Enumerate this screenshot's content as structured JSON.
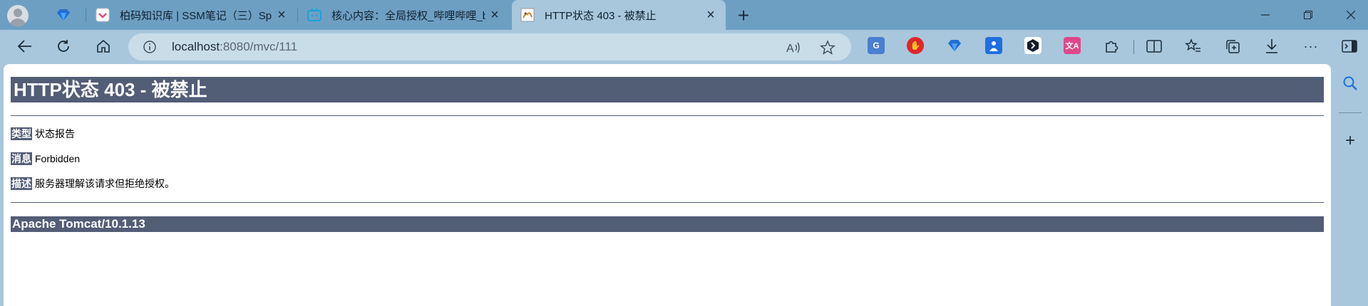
{
  "tabs": [
    {
      "title": "柏码知识库 | SSM笔记（三）Spring",
      "active": false
    },
    {
      "title": "核心内容：全局授权_哔哩哔哩_bilibili",
      "active": false
    },
    {
      "title": "HTTP状态 403 - 被禁止",
      "active": true
    }
  ],
  "address_bar": {
    "host": "localhost",
    "path": ":8080/mvc/111"
  },
  "page": {
    "heading": "HTTP状态 403 - 被禁止",
    "rows": [
      {
        "key": "类型",
        "value": "状态报告"
      },
      {
        "key": "消息",
        "value": "Forbidden"
      },
      {
        "key": "描述",
        "value": "服务器理解该请求但拒绝授权。"
      }
    ],
    "footer": "Apache Tomcat/10.1.13"
  },
  "extensions": [
    {
      "name": "google-translate-icon",
      "color": "#4a7fd1",
      "label": "G"
    },
    {
      "name": "adblock-icon",
      "color": "#e0262b",
      "label": "✋"
    },
    {
      "name": "diamond-extension-icon",
      "color": "#1f6fd8",
      "label": ""
    },
    {
      "name": "person-extension-icon",
      "color": "#1d6fe0",
      "label": ""
    },
    {
      "name": "hex-extension-icon",
      "color": "#0f1b2b",
      "label": ""
    },
    {
      "name": "translate-icon",
      "color": "#e0478a",
      "label": "文A"
    }
  ],
  "colors": {
    "tomcat_header": "#525d76",
    "chrome_frame": "#a8c7dc",
    "tab_strip": "#6d9fc3"
  }
}
